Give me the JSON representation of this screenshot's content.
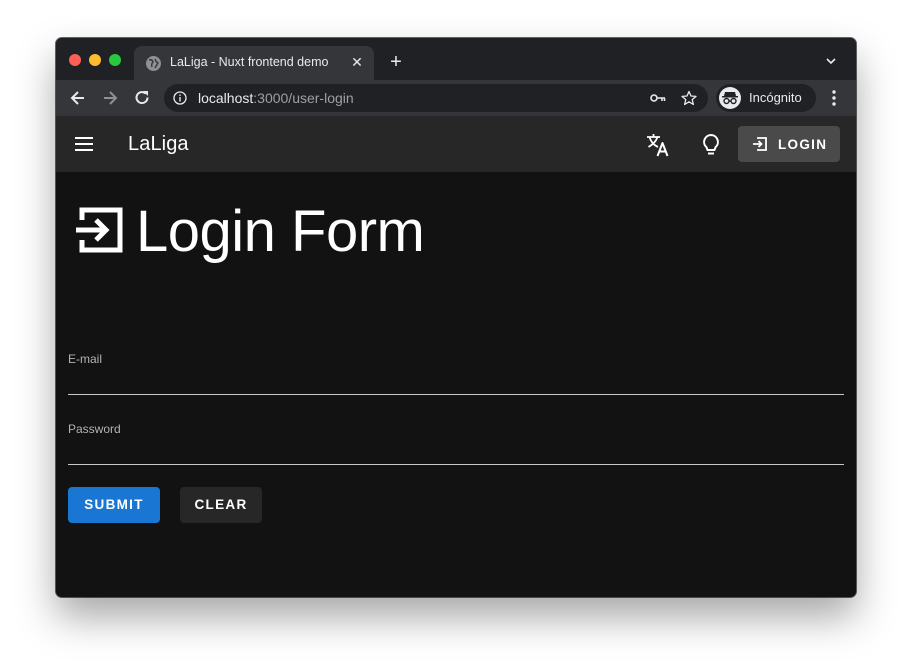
{
  "browser": {
    "tab_title": "LaLiga - Nuxt frontend demo",
    "url_host": "localhost",
    "url_path": ":3000/user-login",
    "profile_label": "Incógnito"
  },
  "appbar": {
    "title": "LaLiga",
    "login_label": "LOGIN"
  },
  "main": {
    "heading": "Login Form",
    "email_label": "E-mail",
    "password_label": "Password",
    "submit_label": "SUBMIT",
    "clear_label": "CLEAR"
  },
  "colors": {
    "background": "#121212",
    "appbar": "#272727",
    "primary": "#1976d2",
    "login_button": "#4a4a4a"
  },
  "icons": [
    "globe-icon",
    "close-icon",
    "plus-icon",
    "chevron-down-icon",
    "back-arrow-icon",
    "forward-arrow-icon",
    "reload-icon",
    "info-icon",
    "key-icon",
    "star-icon",
    "incognito-icon",
    "kebab-menu-icon",
    "hamburger-icon",
    "translate-icon",
    "lightbulb-icon",
    "login-icon"
  ]
}
